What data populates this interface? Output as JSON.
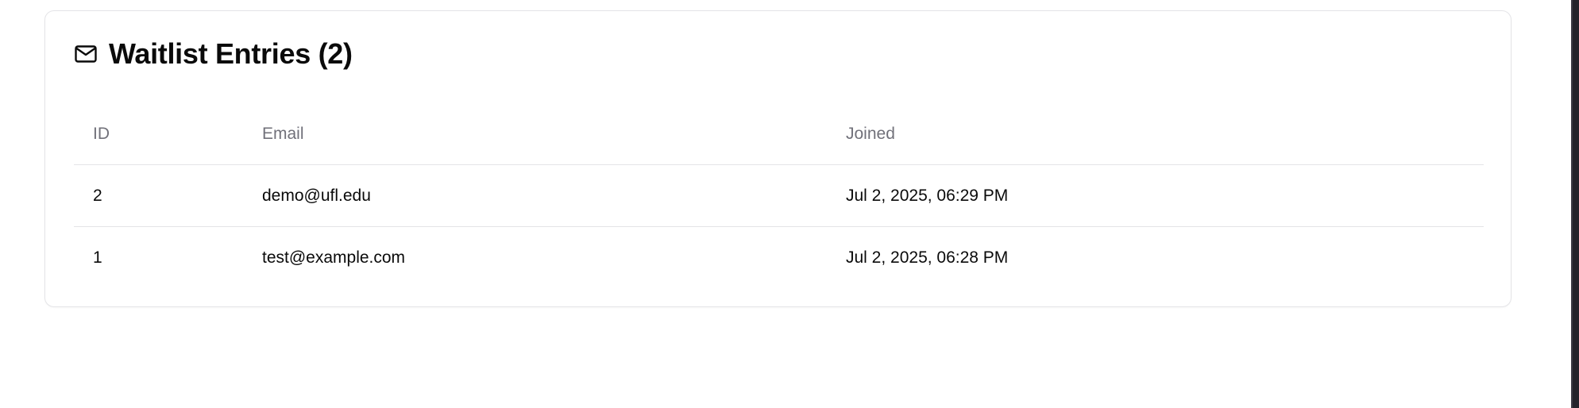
{
  "card": {
    "icon": "mail-icon",
    "title": "Waitlist Entries (2)"
  },
  "table": {
    "columns": [
      "ID",
      "Email",
      "Joined"
    ],
    "rows": [
      {
        "id": "2",
        "email": "demo@ufl.edu",
        "joined": "Jul 2, 2025, 06:29 PM"
      },
      {
        "id": "1",
        "email": "test@example.com",
        "joined": "Jul 2, 2025, 06:28 PM"
      }
    ]
  }
}
